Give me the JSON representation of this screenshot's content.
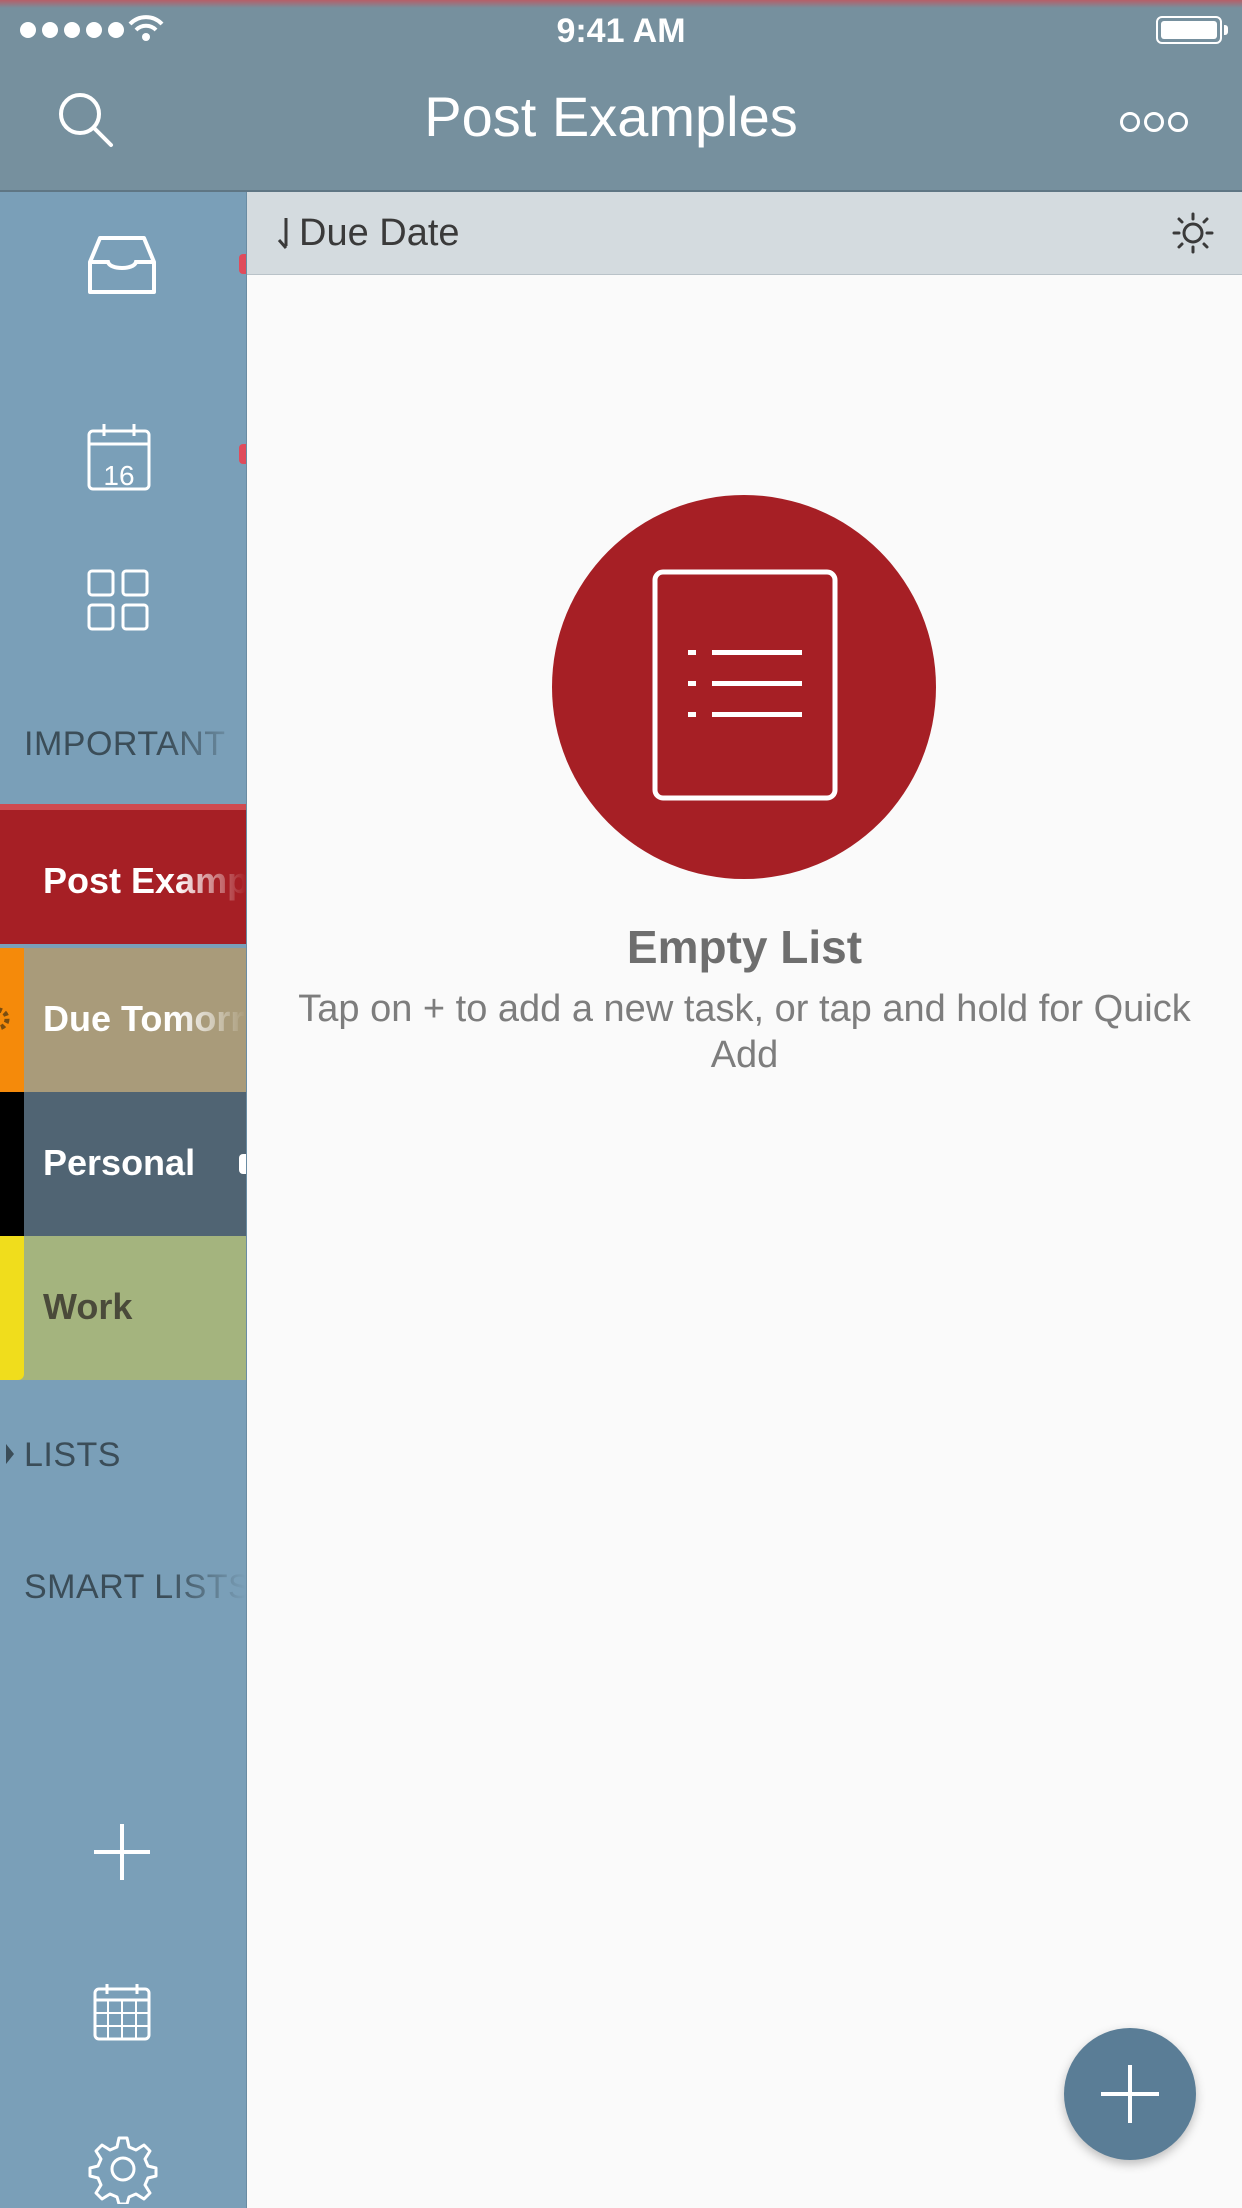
{
  "status_bar": {
    "time": "9:41 AM"
  },
  "nav": {
    "title": "Post Examples",
    "search_icon": "search-icon",
    "more_icon": "more-icon"
  },
  "sidebar": {
    "calendar_day": "16",
    "important_header": "IMPORTANT",
    "lists_header": "LISTS",
    "smart_lists_header": "SMART LISTS",
    "items": [
      {
        "label": "Post Examples",
        "bg": "#a61f25",
        "stripe": "#a61f25",
        "text_color": "#ffffff"
      },
      {
        "label": "Due Tomorrow",
        "bg": "#a99b7a",
        "stripe": "#f58a0a",
        "text_color": "#ffffff"
      },
      {
        "label": "Personal",
        "bg": "#506473",
        "stripe": "#000000",
        "text_color": "#ffffff"
      },
      {
        "label": "Work",
        "bg": "#a4b47e",
        "stripe": "#f0dd1c",
        "text_color": "#4a4a3a"
      }
    ]
  },
  "content": {
    "sort_label": "Due Date",
    "empty_title": "Empty List",
    "empty_subtitle": "Tap on + to add a new task, or tap and hold for Quick Add"
  },
  "colors": {
    "nav_bg": "#76909e",
    "sidebar_bg": "#7a9fb8",
    "accent_red": "#a61f25",
    "fab": "#5a7d96"
  }
}
